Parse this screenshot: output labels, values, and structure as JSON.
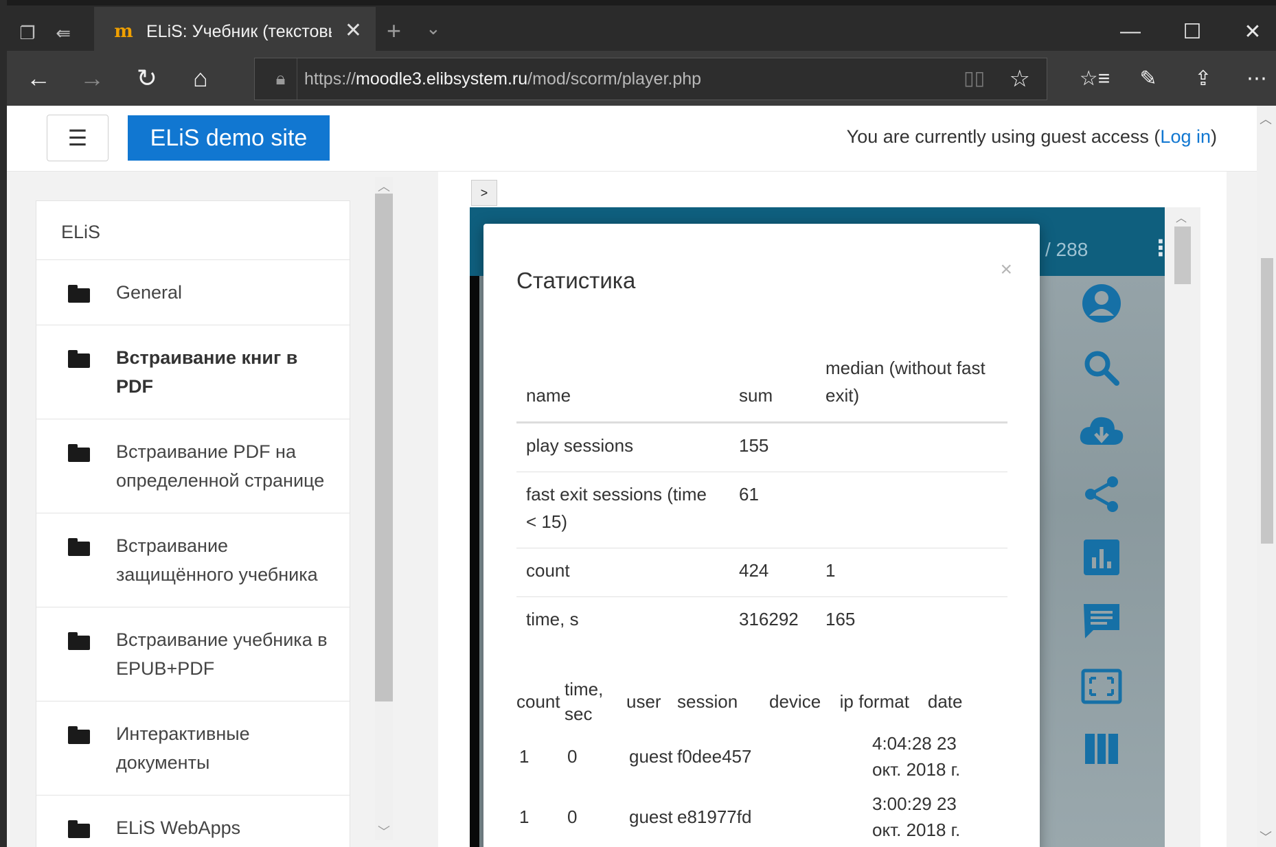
{
  "browser": {
    "tab_title": "ELiS: Учебник (текстовый",
    "tab_favicon": "m",
    "url_scheme": "https://",
    "url_host": "moodle3.elibsystem.ru",
    "url_path": "/mod/scorm/player.php",
    "icons": {
      "tab_preview": "tabs-icon",
      "set_aside": "set-aside-icon",
      "back": "back-arrow-icon",
      "forward": "forward-arrow-icon",
      "refresh": "refresh-icon",
      "home": "home-icon",
      "lock": "lock-icon",
      "reading_view": "book-icon",
      "favorite": "star-icon",
      "favorites_hub": "favorites-list-icon",
      "notes": "pen-icon",
      "share": "share-icon",
      "more": "more-icon"
    }
  },
  "header": {
    "brand": "ELiS demo site",
    "guest_text": "You are currently using guest access (",
    "login_link": "Log in",
    "guest_text_end": ")"
  },
  "sidebar": {
    "heading": "ELiS",
    "items": [
      {
        "label": "General",
        "bold": false
      },
      {
        "label": "Встраивание книг в PDF",
        "bold": true
      },
      {
        "label": "Встраивание PDF на определенной странице",
        "bold": false
      },
      {
        "label": "Встраивание защищённого учебника",
        "bold": false
      },
      {
        "label": "Встраивание учебника в EPUB+PDF",
        "bold": false
      },
      {
        "label": "Интерактивные документы",
        "bold": false
      },
      {
        "label": "ELiS WebApps",
        "bold": false
      }
    ]
  },
  "player": {
    "toggle_label": ">",
    "page_count": "/ 288",
    "tools": [
      "user-icon",
      "search-icon",
      "cloud-download-icon",
      "share-icon",
      "bar-chart-icon",
      "comment-icon",
      "fullscreen-icon",
      "columns-icon"
    ]
  },
  "stats_dialog": {
    "title": "Статистика",
    "close": "×",
    "headers": [
      "name",
      "sum",
      "median (without fast exit)"
    ],
    "rows": [
      [
        "play sessions",
        "155",
        ""
      ],
      [
        "fast exit sessions (time < 15)",
        "61",
        ""
      ],
      [
        "count",
        "424",
        "1"
      ],
      [
        "time, s",
        "316292",
        "165"
      ]
    ],
    "session_headers": [
      "count",
      "time, sec",
      "user",
      "session",
      "device",
      "ip",
      "format",
      "date"
    ],
    "sessions": [
      {
        "count": "1",
        "time": "0",
        "user": "guest",
        "session": "f0dee457",
        "date": "4:04:28 23 окт. 2018 г."
      },
      {
        "count": "1",
        "time": "0",
        "user": "guest",
        "session": "e81977fd",
        "date": "3:00:29 23 окт. 2018 г."
      }
    ]
  }
}
